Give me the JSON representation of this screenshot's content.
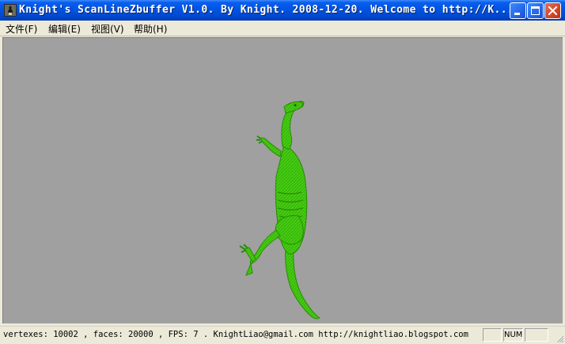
{
  "window": {
    "title": "Knight's ScanLineZbuffer V1.0. By Knight. 2008-12-20.  Welcome to http://K...",
    "icon": "app-icon",
    "controls": [
      "minimize-icon",
      "maximize-icon",
      "close-icon"
    ]
  },
  "menu": {
    "items": [
      {
        "label": "文件(F)"
      },
      {
        "label": "编辑(E)"
      },
      {
        "label": "视图(V)"
      },
      {
        "label": "帮助(H)"
      }
    ]
  },
  "viewport": {
    "background_color": "#a0a0a0",
    "model_color": "#44cc11",
    "model": "green dinosaur mesh"
  },
  "status": {
    "text": "vertexes: 10002 , faces: 20000 , FPS: 7 .  KnightLiao@gmail.com  http://knightliao.blogspot.com",
    "panes": [
      "",
      "NUM",
      ""
    ]
  }
}
